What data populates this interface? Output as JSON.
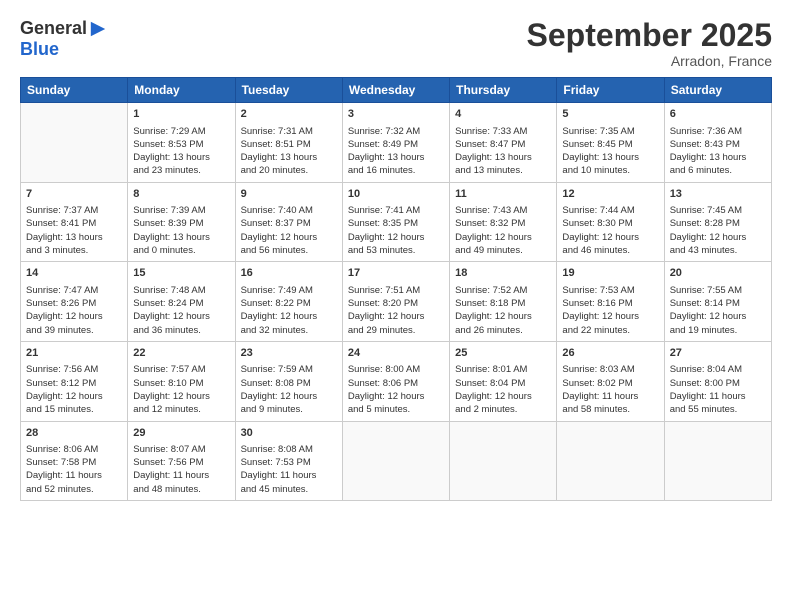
{
  "logo": {
    "general": "General",
    "blue": "Blue"
  },
  "header": {
    "month": "September 2025",
    "location": "Arradon, France"
  },
  "weekdays": [
    "Sunday",
    "Monday",
    "Tuesday",
    "Wednesday",
    "Thursday",
    "Friday",
    "Saturday"
  ],
  "weeks": [
    [
      {
        "day": "",
        "lines": []
      },
      {
        "day": "1",
        "lines": [
          "Sunrise: 7:29 AM",
          "Sunset: 8:53 PM",
          "Daylight: 13 hours",
          "and 23 minutes."
        ]
      },
      {
        "day": "2",
        "lines": [
          "Sunrise: 7:31 AM",
          "Sunset: 8:51 PM",
          "Daylight: 13 hours",
          "and 20 minutes."
        ]
      },
      {
        "day": "3",
        "lines": [
          "Sunrise: 7:32 AM",
          "Sunset: 8:49 PM",
          "Daylight: 13 hours",
          "and 16 minutes."
        ]
      },
      {
        "day": "4",
        "lines": [
          "Sunrise: 7:33 AM",
          "Sunset: 8:47 PM",
          "Daylight: 13 hours",
          "and 13 minutes."
        ]
      },
      {
        "day": "5",
        "lines": [
          "Sunrise: 7:35 AM",
          "Sunset: 8:45 PM",
          "Daylight: 13 hours",
          "and 10 minutes."
        ]
      },
      {
        "day": "6",
        "lines": [
          "Sunrise: 7:36 AM",
          "Sunset: 8:43 PM",
          "Daylight: 13 hours",
          "and 6 minutes."
        ]
      }
    ],
    [
      {
        "day": "7",
        "lines": [
          "Sunrise: 7:37 AM",
          "Sunset: 8:41 PM",
          "Daylight: 13 hours",
          "and 3 minutes."
        ]
      },
      {
        "day": "8",
        "lines": [
          "Sunrise: 7:39 AM",
          "Sunset: 8:39 PM",
          "Daylight: 13 hours",
          "and 0 minutes."
        ]
      },
      {
        "day": "9",
        "lines": [
          "Sunrise: 7:40 AM",
          "Sunset: 8:37 PM",
          "Daylight: 12 hours",
          "and 56 minutes."
        ]
      },
      {
        "day": "10",
        "lines": [
          "Sunrise: 7:41 AM",
          "Sunset: 8:35 PM",
          "Daylight: 12 hours",
          "and 53 minutes."
        ]
      },
      {
        "day": "11",
        "lines": [
          "Sunrise: 7:43 AM",
          "Sunset: 8:32 PM",
          "Daylight: 12 hours",
          "and 49 minutes."
        ]
      },
      {
        "day": "12",
        "lines": [
          "Sunrise: 7:44 AM",
          "Sunset: 8:30 PM",
          "Daylight: 12 hours",
          "and 46 minutes."
        ]
      },
      {
        "day": "13",
        "lines": [
          "Sunrise: 7:45 AM",
          "Sunset: 8:28 PM",
          "Daylight: 12 hours",
          "and 43 minutes."
        ]
      }
    ],
    [
      {
        "day": "14",
        "lines": [
          "Sunrise: 7:47 AM",
          "Sunset: 8:26 PM",
          "Daylight: 12 hours",
          "and 39 minutes."
        ]
      },
      {
        "day": "15",
        "lines": [
          "Sunrise: 7:48 AM",
          "Sunset: 8:24 PM",
          "Daylight: 12 hours",
          "and 36 minutes."
        ]
      },
      {
        "day": "16",
        "lines": [
          "Sunrise: 7:49 AM",
          "Sunset: 8:22 PM",
          "Daylight: 12 hours",
          "and 32 minutes."
        ]
      },
      {
        "day": "17",
        "lines": [
          "Sunrise: 7:51 AM",
          "Sunset: 8:20 PM",
          "Daylight: 12 hours",
          "and 29 minutes."
        ]
      },
      {
        "day": "18",
        "lines": [
          "Sunrise: 7:52 AM",
          "Sunset: 8:18 PM",
          "Daylight: 12 hours",
          "and 26 minutes."
        ]
      },
      {
        "day": "19",
        "lines": [
          "Sunrise: 7:53 AM",
          "Sunset: 8:16 PM",
          "Daylight: 12 hours",
          "and 22 minutes."
        ]
      },
      {
        "day": "20",
        "lines": [
          "Sunrise: 7:55 AM",
          "Sunset: 8:14 PM",
          "Daylight: 12 hours",
          "and 19 minutes."
        ]
      }
    ],
    [
      {
        "day": "21",
        "lines": [
          "Sunrise: 7:56 AM",
          "Sunset: 8:12 PM",
          "Daylight: 12 hours",
          "and 15 minutes."
        ]
      },
      {
        "day": "22",
        "lines": [
          "Sunrise: 7:57 AM",
          "Sunset: 8:10 PM",
          "Daylight: 12 hours",
          "and 12 minutes."
        ]
      },
      {
        "day": "23",
        "lines": [
          "Sunrise: 7:59 AM",
          "Sunset: 8:08 PM",
          "Daylight: 12 hours",
          "and 9 minutes."
        ]
      },
      {
        "day": "24",
        "lines": [
          "Sunrise: 8:00 AM",
          "Sunset: 8:06 PM",
          "Daylight: 12 hours",
          "and 5 minutes."
        ]
      },
      {
        "day": "25",
        "lines": [
          "Sunrise: 8:01 AM",
          "Sunset: 8:04 PM",
          "Daylight: 12 hours",
          "and 2 minutes."
        ]
      },
      {
        "day": "26",
        "lines": [
          "Sunrise: 8:03 AM",
          "Sunset: 8:02 PM",
          "Daylight: 11 hours",
          "and 58 minutes."
        ]
      },
      {
        "day": "27",
        "lines": [
          "Sunrise: 8:04 AM",
          "Sunset: 8:00 PM",
          "Daylight: 11 hours",
          "and 55 minutes."
        ]
      }
    ],
    [
      {
        "day": "28",
        "lines": [
          "Sunrise: 8:06 AM",
          "Sunset: 7:58 PM",
          "Daylight: 11 hours",
          "and 52 minutes."
        ]
      },
      {
        "day": "29",
        "lines": [
          "Sunrise: 8:07 AM",
          "Sunset: 7:56 PM",
          "Daylight: 11 hours",
          "and 48 minutes."
        ]
      },
      {
        "day": "30",
        "lines": [
          "Sunrise: 8:08 AM",
          "Sunset: 7:53 PM",
          "Daylight: 11 hours",
          "and 45 minutes."
        ]
      },
      {
        "day": "",
        "lines": []
      },
      {
        "day": "",
        "lines": []
      },
      {
        "day": "",
        "lines": []
      },
      {
        "day": "",
        "lines": []
      }
    ]
  ]
}
